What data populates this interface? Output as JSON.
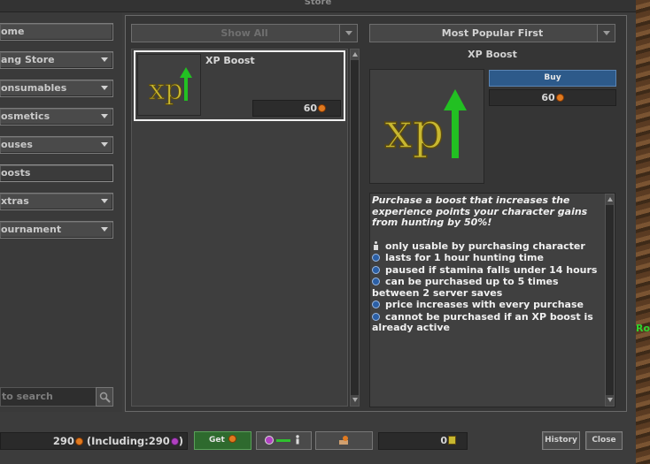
{
  "window": {
    "title": "Store"
  },
  "sidebar": {
    "items": [
      {
        "label": "ome",
        "has_arrow": false
      },
      {
        "label": "ang Store",
        "has_arrow": true
      },
      {
        "label": "onsumables",
        "has_arrow": true
      },
      {
        "label": "osmetics",
        "has_arrow": true
      },
      {
        "label": "ouses",
        "has_arrow": true
      },
      {
        "label": "oosts",
        "has_arrow": false,
        "active": true
      },
      {
        "label": "xtras",
        "has_arrow": true
      },
      {
        "label": "ournament",
        "has_arrow": true
      }
    ],
    "search_placeholder": "to search"
  },
  "filters": {
    "show_all": "Show All",
    "sort": "Most Popular First"
  },
  "offers": [
    {
      "name": "XP Boost",
      "price": "60",
      "icon": "xp-boost-icon",
      "selected": true
    }
  ],
  "detail": {
    "title": "XP Boost",
    "buy_label": "Buy",
    "price": "60",
    "intro": "Purchase a boost that increases the experience points your character gains from hunting by 50%!",
    "bullets": [
      {
        "icon": "person-icon",
        "text": "only usable by purchasing character"
      },
      {
        "icon": "info-icon",
        "text": "lasts for 1 hour hunting time"
      },
      {
        "icon": "info-icon",
        "text": "paused if stamina falls under 14 hours"
      },
      {
        "icon": "info-icon",
        "text": "can be purchased up to 5 times between 2 server saves"
      },
      {
        "icon": "info-icon",
        "text": "price increases with every purchase"
      },
      {
        "icon": "info-icon",
        "text": "cannot be purchased if an XP boost is already active"
      }
    ]
  },
  "footer": {
    "balance": "290",
    "including_prefix": "(Including:",
    "including_value": "290",
    "including_suffix": ")",
    "get_label": "Get",
    "tokens": "0",
    "history_label": "History",
    "close_label": "Close"
  },
  "side_label": "Ro",
  "colors": {
    "buy_button": "#2d5a8a",
    "get_button": "#2e6a2e",
    "selected_border": "#f0f0f0",
    "xp_text": "#c8b830",
    "xp_arrow": "#22c022"
  }
}
